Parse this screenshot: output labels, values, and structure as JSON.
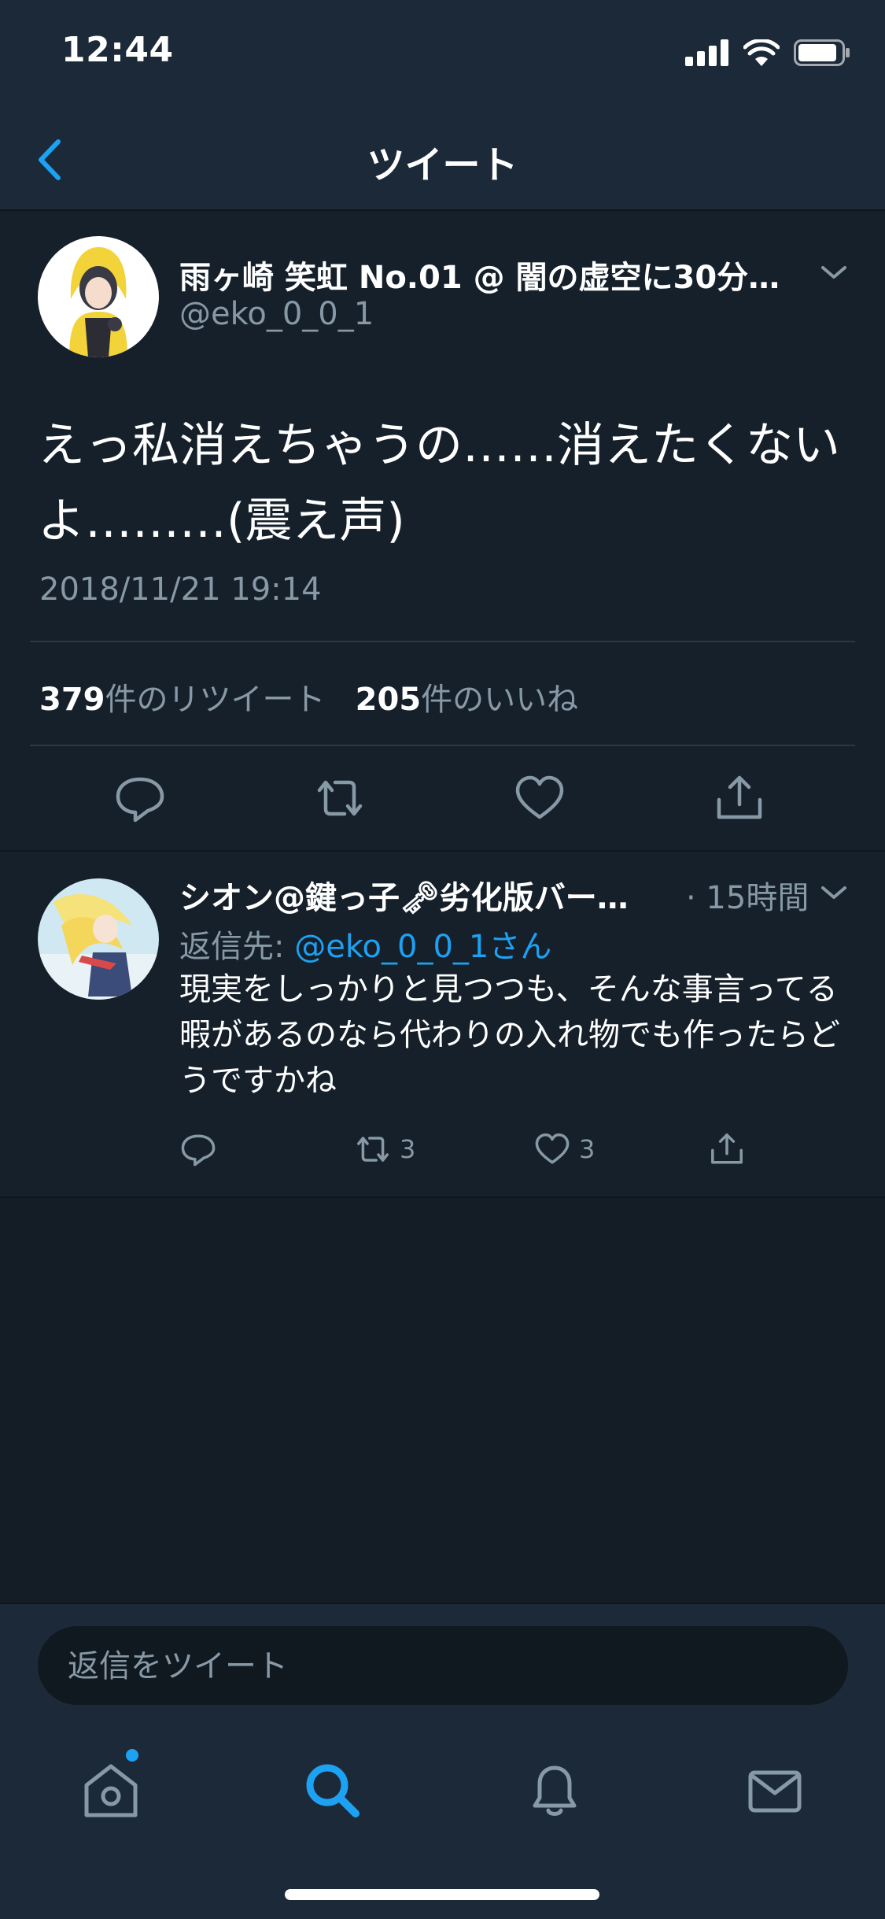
{
  "status_bar": {
    "time": "12:44"
  },
  "nav": {
    "title": "ツイート"
  },
  "main_tweet": {
    "display_name": "雨ヶ崎 笑虹 No.01 @ 闇の虚空に30分…",
    "handle": "@eko_0_0_1",
    "text": "えっ私消えちゃうの……消えたくないよ………(震え声)",
    "timestamp": "2018/11/21 19:14",
    "retweet_count": "379",
    "retweet_label": "件のリツイート",
    "like_count": "205",
    "like_label": "件のいいね"
  },
  "reply": {
    "display_name": "シオン@鍵っ子🗝劣化版バー…",
    "time": "· 15時間",
    "reply_to_label": "返信先:",
    "reply_to_mention": "@eko_0_0_1さん",
    "text": "現実をしっかりと見つつも、そんな事言ってる暇があるのなら代わりの入れ物でも作ったらどうですかね",
    "retweet_count": "3",
    "like_count": "3"
  },
  "compose": {
    "placeholder": "返信をツイート"
  },
  "tabs": [
    "home-icon",
    "search-icon",
    "notifications-icon",
    "messages-icon"
  ],
  "colors": {
    "accent": "#1da1f2",
    "background": "#15202b",
    "bar": "#1c2938",
    "secondary_text": "#8899a6"
  }
}
